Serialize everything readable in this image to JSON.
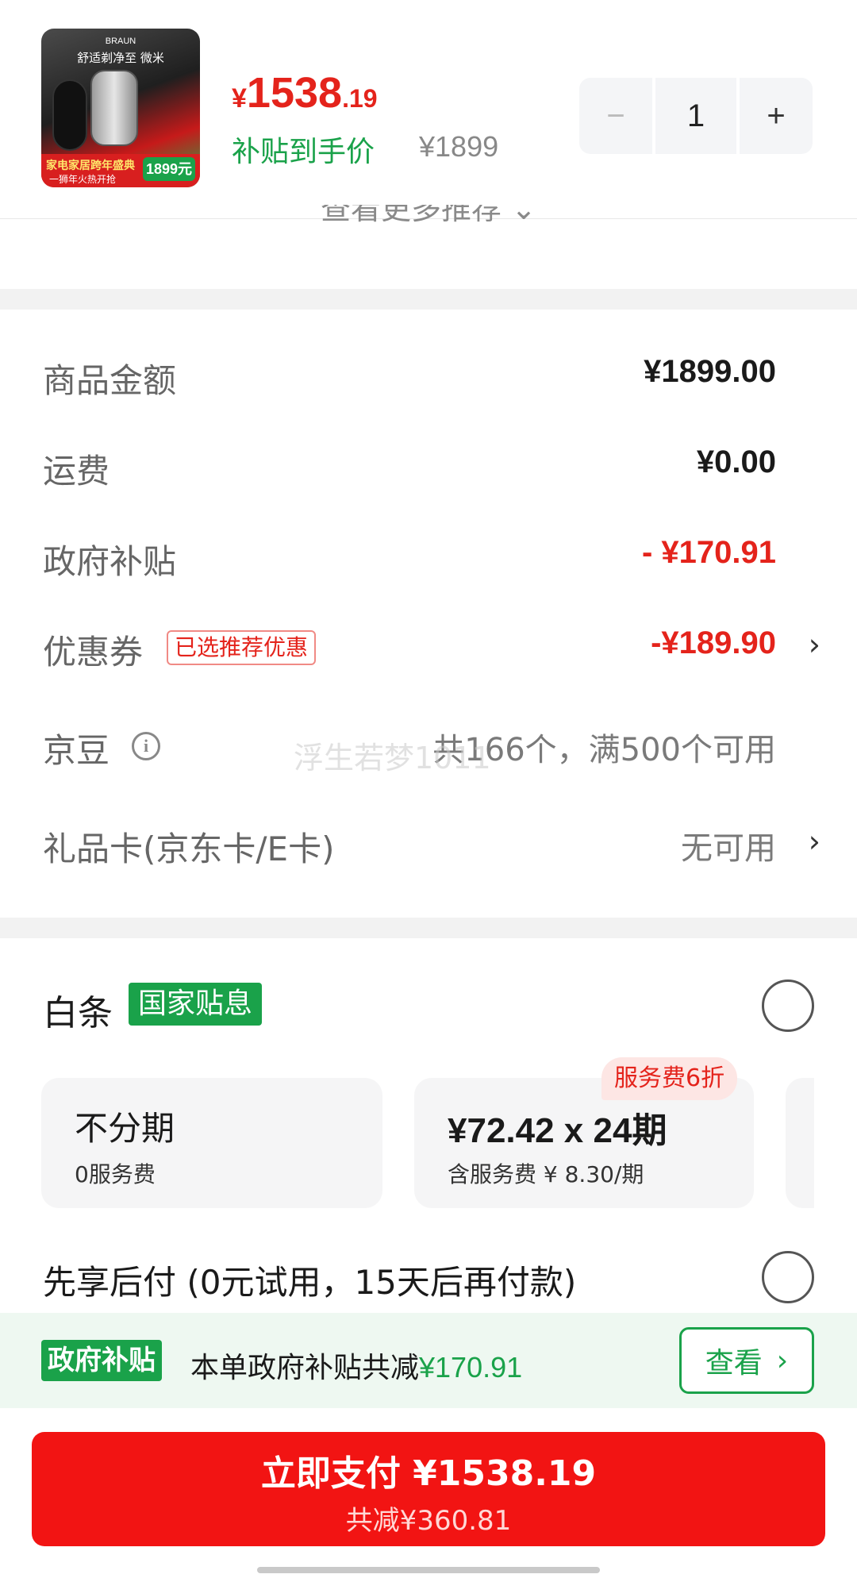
{
  "product": {
    "thumb": {
      "brand": "BRAUN",
      "headline": "舒适剃净至 微米",
      "promo": "家电家居跨年盛典",
      "promo_sub": "一狮年火热开抢",
      "tag_price": "1899元"
    },
    "price_yen": "¥",
    "price_int": "1538",
    "price_dec": ".19",
    "subsidy_label": "补贴到手价",
    "original_price": "¥1899",
    "quantity": "1",
    "minus": "−",
    "plus": "+"
  },
  "more_recommend": "查看更多推荐 ⌄",
  "summary": {
    "goods_amount_label": "商品金额",
    "goods_amount": "¥1899.00",
    "shipping_label": "运费",
    "shipping": "¥0.00",
    "gov_subsidy_label": "政府补贴",
    "gov_subsidy": "- ¥170.91",
    "coupon_label": "优惠券",
    "coupon_tag": "已选推荐优惠",
    "coupon": "-¥189.90",
    "jingdou_label": "京豆",
    "jingdou": "共166个，满500个可用",
    "giftcard_label": "礼品卡(京东卡/E卡)",
    "giftcard": "无可用",
    "watermark": "浮生若梦1011"
  },
  "baitiao": {
    "title": "白条",
    "badge": "国家贴息",
    "plans": [
      {
        "main": "不分期",
        "sub": "0服务费"
      },
      {
        "main": "¥72.42 x 24期",
        "sub": "含服务费 ¥ 8.30/期",
        "badge": "服务费6折"
      }
    ]
  },
  "bnpl": "先享后付 (0元试用，15天后再付款)",
  "subsidy_strip": {
    "badge": "政府补贴",
    "text": "本单政府补贴共减",
    "amount": "¥170.91",
    "button": "查看"
  },
  "pay": {
    "main": "立即支付 ¥1538.19",
    "sub": "共减¥360.81"
  },
  "colors": {
    "accent_red": "#e4231b",
    "accent_green": "#1aa24a",
    "pay_button": "#f21413"
  }
}
